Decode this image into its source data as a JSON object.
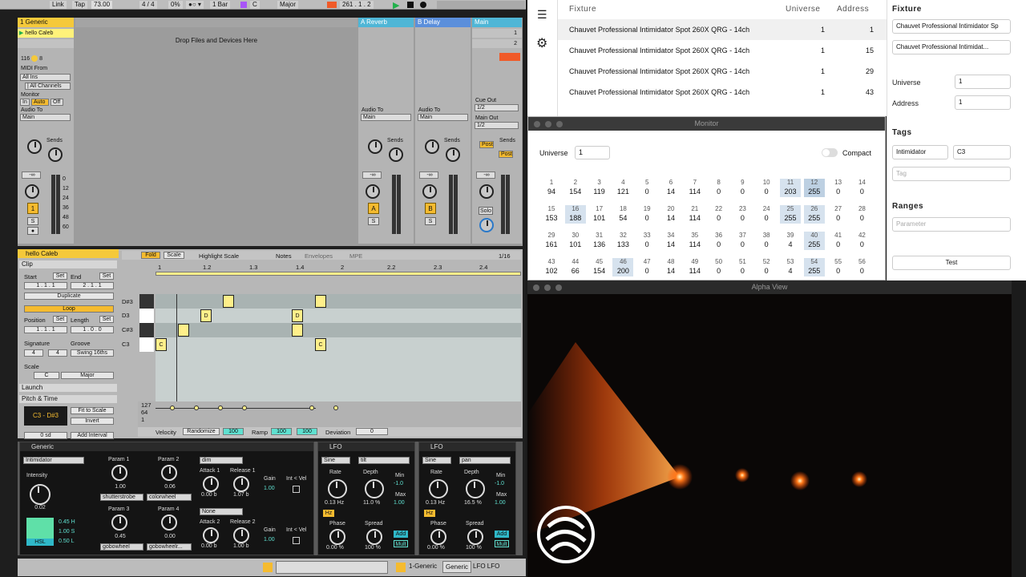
{
  "ableton": {
    "topbar": {
      "link": "Link",
      "tap": "Tap",
      "tempo": "73.00",
      "sig": "4 / 4",
      "pct": "0%",
      "quant": "1 Bar",
      "key": "C",
      "scale": "Major",
      "position": "261 . 1 . 2"
    },
    "tracks": [
      {
        "name": "1 Generic",
        "color": "#f5c93a"
      },
      {
        "name": "A Reverb",
        "color": "#4fb6d6"
      },
      {
        "name": "B Delay",
        "color": "#5b8fdb"
      },
      {
        "name": "Main",
        "color": "#4fb6d6"
      }
    ],
    "clip_slot": "hello Caleb",
    "drop_text": "Drop Files and Devices Here",
    "main_slots": [
      "1",
      "2"
    ],
    "midi": {
      "cpu": "116",
      "count": "8",
      "midi_from": "MIDI From",
      "all_ins": "All Ins",
      "all_channels": "| All Channels",
      "monitor": "Monitor",
      "in": "In",
      "auto": "Auto",
      "off": "Off",
      "audio_to": "Audio To",
      "main": "Main"
    },
    "sends": "Sends",
    "cue_out": "Cue Out",
    "cue_val": "1/2",
    "main_out": "Main Out",
    "main_out_val": "1/2",
    "post": "Post",
    "solo": "Solo",
    "vol_inf": "-∞",
    "meter_ticks": [
      "0",
      "12",
      "24",
      "36",
      "48",
      "60"
    ],
    "track_num": "1",
    "s": "S",
    "a": "A",
    "b": "B",
    "clip": {
      "name": "hello Caleb",
      "section": "Clip",
      "start": "Start",
      "set": "Set",
      "end": "End",
      "start_val": "1 . 1 . 1",
      "end_val": "2 . 1 . 1",
      "duplicate": "Duplicate",
      "loop": "Loop",
      "position": "Position",
      "length": "Length",
      "pos_val": "1 . 1 . 1",
      "len_val": "1 . 0 . 0",
      "signature": "Signature",
      "groove": "Groove",
      "sig_num": "4",
      "sig_den": "4",
      "swing": "Swing 16ths",
      "scale": "Scale",
      "scale_key": "C",
      "scale_mode": "Major",
      "launch": "Launch",
      "pitch": "Pitch & Time",
      "range": "C3 - D#3",
      "fit": "Fit to Scale",
      "invert": "Invert",
      "add_interval": "Add Interval",
      "sd": "0 sd",
      "tabs": [
        "Fold",
        "Scale",
        "Highlight Scale",
        "Notes",
        "Envelopes",
        "MPE"
      ],
      "grid": "1/16",
      "ruler": [
        "1",
        "1.2",
        "1.3",
        "1.4",
        "2",
        "2.2",
        "2.3",
        "2.4"
      ],
      "keys": [
        "D#3",
        "D3",
        "C#3",
        "C3"
      ],
      "notes": [
        "C",
        "D",
        "D",
        "C"
      ],
      "vel_ticks": [
        "127",
        "64",
        "1"
      ],
      "velocity": "Velocity",
      "randomize": "Randomize",
      "vel_val": "100",
      "ramp": "Ramp",
      "ramp_a": "100",
      "ramp_b": "100",
      "deviation": "Deviation",
      "dev_val": "0"
    },
    "devices": {
      "generic": {
        "title": "Generic",
        "sel": "Intimidator",
        "intensity": "Intensity",
        "int_val": "0.02",
        "p1": "Param 1",
        "p1v": "1.00",
        "p1s": "shutterstrobe",
        "p2": "Param 2",
        "p2v": "0.06",
        "p2s": "colorwheel",
        "p3": "Param 3",
        "p3v": "0.45",
        "p3s": "gobowheel",
        "p4": "Param 4",
        "p4v": "0.00",
        "p4s": "gobowheelr...",
        "h": "0.45 H",
        "s": "1.00 S",
        "l": "0.50 L",
        "hsl": "HSL",
        "env1": "dim",
        "a1": "Attack 1",
        "a1v": "0.00 b",
        "r1": "Release 1",
        "r1v": "1.07 b",
        "gain": "Gain",
        "g1": "1.00",
        "intvel": "Int < Vel",
        "env2": "None",
        "a2": "Attack 2",
        "a2v": "0.00 b",
        "r2": "Release 2",
        "r2v": "1.00 b",
        "g2": "1.00"
      },
      "lfo1": {
        "title": "LFO",
        "wave": "Sine",
        "target": "tilt",
        "rate": "Rate",
        "rate_v": "0.13 Hz",
        "hz": "Hz",
        "depth": "Depth",
        "depth_v": "11.0 %",
        "min": "Min",
        "min_v": "-1.0",
        "max": "Max",
        "max_v": "1.00",
        "phase": "Phase",
        "phase_v": "0.00 %",
        "spread": "Spread",
        "spread_v": "100 %",
        "add": "Add",
        "mult": "Mult"
      },
      "lfo2": {
        "title": "LFO",
        "wave": "Sine",
        "target": "pan",
        "rate": "Rate",
        "rate_v": "0.13 Hz",
        "hz": "Hz",
        "depth": "Depth",
        "depth_v": "16.5 %",
        "min": "Min",
        "min_v": "-1.0",
        "max": "Max",
        "max_v": "1.00",
        "phase": "Phase",
        "phase_v": "0.00 %",
        "spread": "Spread",
        "spread_v": "100 %",
        "add": "Add",
        "mult": "Mult"
      }
    },
    "status": {
      "track": "1-Generic",
      "chain": "Generic",
      "lfo": "LFO LFO"
    }
  },
  "fixtures": {
    "headers": [
      "Fixture",
      "Universe",
      "Address"
    ],
    "rows": [
      {
        "name": "Chauvet Professional Intimidator Spot 260X QRG - 14ch",
        "universe": "1",
        "address": "1"
      },
      {
        "name": "Chauvet Professional Intimidator Spot 260X QRG - 14ch",
        "universe": "1",
        "address": "15"
      },
      {
        "name": "Chauvet Professional Intimidator Spot 260X QRG - 14ch",
        "universe": "1",
        "address": "29"
      },
      {
        "name": "Chauvet Professional Intimidator Spot 260X QRG - 14ch",
        "universe": "1",
        "address": "43"
      }
    ]
  },
  "inspector": {
    "fixture": "Fixture",
    "fixture_name": "Chauvet Professional Intimidator Sp",
    "fixture_select": "Chauvet Professional Intimidat...",
    "universe": "Universe",
    "universe_val": "1",
    "address": "Address",
    "address_val": "1",
    "tags": "Tags",
    "tag1": "Intimidator",
    "tag2": "C3",
    "tag_placeholder": "Tag",
    "ranges": "Ranges",
    "param_placeholder": "Parameter",
    "test": "Test"
  },
  "monitor": {
    "title": "Monitor",
    "universe": "Universe",
    "universe_val": "1",
    "compact": "Compact",
    "rows": [
      {
        "n": [
          "1",
          "2",
          "3",
          "4",
          "5",
          "6",
          "7",
          "8",
          "9",
          "10",
          "11",
          "12",
          "13",
          "14"
        ],
        "v": [
          "94",
          "154",
          "119",
          "121",
          "0",
          "14",
          "114",
          "0",
          "0",
          "0",
          "203",
          "255",
          "0",
          "0"
        ]
      },
      {
        "n": [
          "15",
          "16",
          "17",
          "18",
          "19",
          "20",
          "21",
          "22",
          "23",
          "24",
          "25",
          "26",
          "27",
          "28"
        ],
        "v": [
          "153",
          "188",
          "101",
          "54",
          "0",
          "14",
          "114",
          "0",
          "0",
          "0",
          "255",
          "255",
          "0",
          "0"
        ]
      },
      {
        "n": [
          "29",
          "30",
          "31",
          "32",
          "33",
          "34",
          "35",
          "36",
          "37",
          "38",
          "39",
          "40",
          "41",
          "42"
        ],
        "v": [
          "161",
          "101",
          "136",
          "133",
          "0",
          "14",
          "114",
          "0",
          "0",
          "0",
          "4",
          "255",
          "0",
          "0"
        ]
      },
      {
        "n": [
          "43",
          "44",
          "45",
          "46",
          "47",
          "48",
          "49",
          "50",
          "51",
          "52",
          "53",
          "54",
          "55",
          "56"
        ],
        "v": [
          "102",
          "66",
          "154",
          "200",
          "0",
          "14",
          "114",
          "0",
          "0",
          "0",
          "4",
          "255",
          "0",
          "0"
        ]
      }
    ]
  },
  "alpha": {
    "title": "Alpha View"
  }
}
